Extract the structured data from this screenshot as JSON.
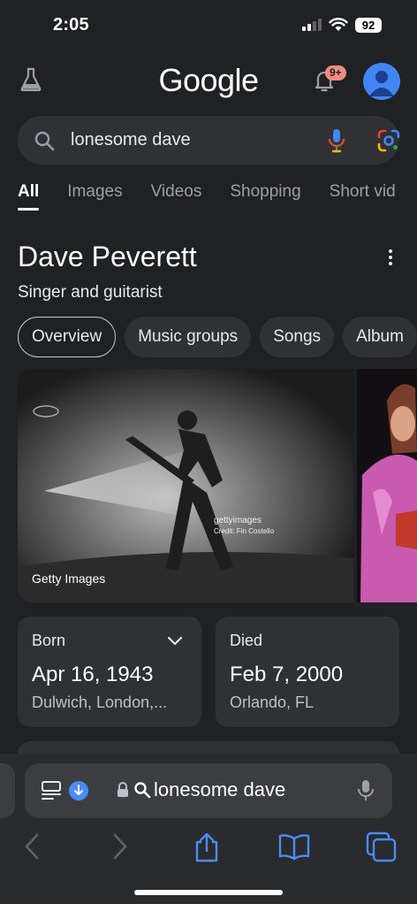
{
  "status": {
    "time": "2:05",
    "battery": "92"
  },
  "header": {
    "logo": "Google",
    "notification_badge": "9+"
  },
  "search": {
    "query": "lonesome dave"
  },
  "tabs": [
    "All",
    "Images",
    "Videos",
    "Shopping",
    "Short vid"
  ],
  "knowledge_panel": {
    "title": "Dave Peverett",
    "subtitle": "Singer and guitarist",
    "chips": [
      "Overview",
      "Music groups",
      "Songs",
      "Album"
    ],
    "image_credit": "Getty Images",
    "watermark": "gettyimages",
    "watermark_credit": "Credit: Fin Costello",
    "born": {
      "label": "Born",
      "date": "Apr 16, 1943",
      "place": "Dulwich, London,..."
    },
    "died": {
      "label": "Died",
      "date": "Feb 7, 2000",
      "place": "Orlando, FL"
    }
  },
  "browser": {
    "address": "lonesome dave"
  },
  "colors": {
    "background": "#202124",
    "surface": "#303134",
    "accent_blue": "#4a8cf7",
    "badge": "#f28b82"
  }
}
